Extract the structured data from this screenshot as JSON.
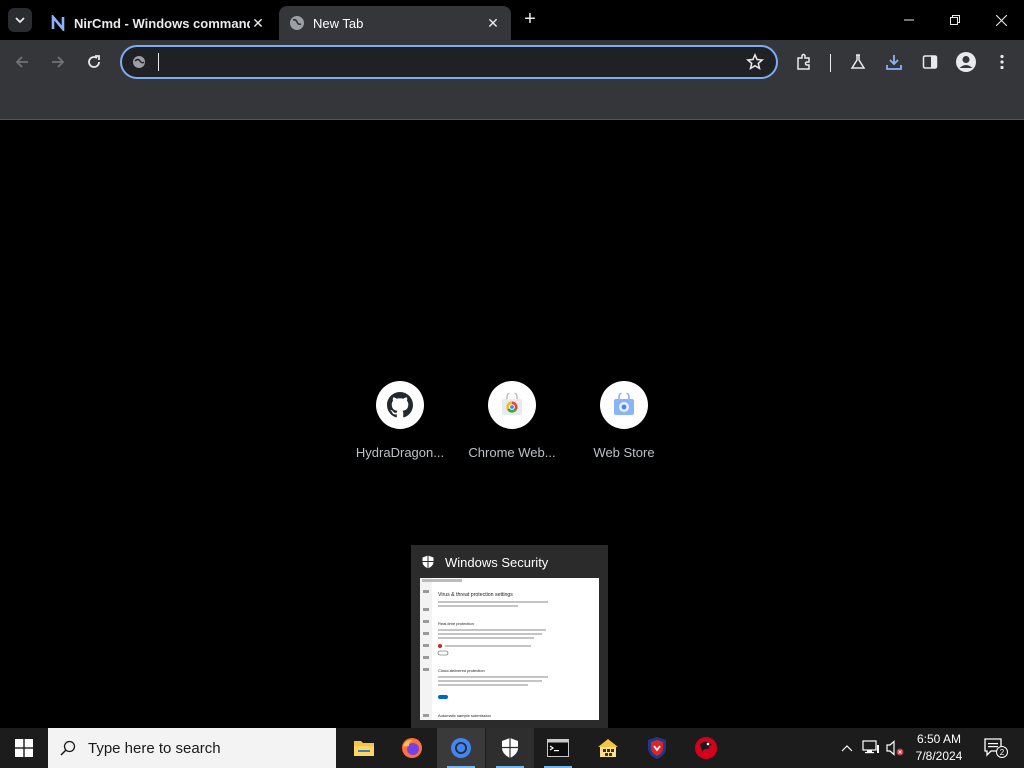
{
  "browser": {
    "tabs": [
      {
        "title": "NirCmd - Windows command l",
        "favicon": "nirsoft-n-icon",
        "active": false
      },
      {
        "title": "New Tab",
        "favicon": "globe-icon",
        "active": true
      }
    ],
    "new_tab_symbol": "+",
    "omnibox": {
      "value": "",
      "placeholder": ""
    },
    "accent_color": "#7cacf8",
    "toolbar_icons": [
      "back-icon",
      "forward-icon",
      "reload-icon",
      "bookmark-star-icon",
      "extensions-icon",
      "labs-flask-icon",
      "download-icon",
      "side-panel-icon",
      "profile-icon",
      "menu-icon"
    ]
  },
  "shortcuts": [
    {
      "label": "HydraDragon...",
      "icon": "github-icon"
    },
    {
      "label": "Chrome Web...",
      "icon": "chrome-web-store-icon"
    },
    {
      "label": "Web Store",
      "icon": "web-store-icon"
    }
  ],
  "security_preview": {
    "title": "Windows Security",
    "thumb": {
      "heading": "Virus & threat protection settings",
      "section1": "Real-time protection",
      "section2": "Cloud-delivered protection",
      "section3": "Automatic sample submission"
    }
  },
  "taskbar": {
    "search_placeholder": "Type here to search",
    "apps": [
      "file-explorer-icon",
      "firefox-icon",
      "chrome-icon",
      "windows-security-icon",
      "command-prompt-icon",
      "network-app-icon",
      "shield-app-icon",
      "red-app-icon"
    ],
    "clock": {
      "time": "6:50 AM",
      "date": "7/8/2024"
    },
    "notification_count": "2"
  }
}
